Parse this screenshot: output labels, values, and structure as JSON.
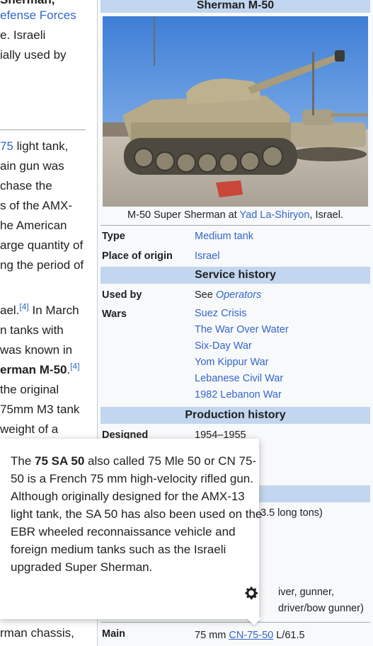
{
  "left_text": {
    "l0": "Sherman,",
    "l1": "efense Forces",
    "l2": "e. Israeli",
    "l3": "ially used by",
    "l4a": "75",
    "l4b": " light tank,",
    "l5": "ain gun was",
    "l6": "chase the",
    "l7": "s of the AMX-",
    "l8": "he American",
    "l9": "arge quantity of",
    "l10": "ng the period of",
    "l11a": "ael.",
    "l11ref": "[4]",
    "l11b": " In March",
    "l12": "n tanks with",
    "l13": " was known in",
    "l14a": "erman M-50",
    "l14b": ".",
    "l14ref": "[4]",
    "l15": " the original",
    "l16": "75mm M3 tank",
    "l17": "weight of a",
    "l18": "rman chassis,"
  },
  "infobox": {
    "title": "Sherman M-50",
    "caption_prefix": "M-50 Super Sherman at ",
    "caption_link": "Yad La-Shiryon",
    "caption_suffix": ", Israel.",
    "type_label": "Type",
    "type_value": "Medium tank",
    "origin_label": "Place of origin",
    "origin_value": "Israel",
    "service_header": "Service history",
    "used_by_label": "Used by",
    "used_by_prefix": "See ",
    "used_by_link": "Operators",
    "wars_label": "Wars",
    "wars": [
      "Suez Crisis",
      "The War Over Water",
      "Six-Day War",
      "Yom Kippur War",
      "Lebanese Civil War",
      "1982 Lebanon War"
    ],
    "production_header": "Production history",
    "designed_label": "Designed",
    "designed_value": "1954–1955",
    "weight_partial": "3.5 long tons)",
    "crew_partial_1": "iver, gunner,",
    "crew_partial_2": "driver/bow gunner)",
    "main_label": "Main",
    "main_prefix": "75 mm ",
    "main_link": "CN-75-50",
    "main_suffix": " L/61.5"
  },
  "popup": {
    "t1": "The ",
    "b1": "75 SA 50",
    "t2": " also called 75 Mle 50 or CN 75-50 is a French 75 mm high-velocity rifled gun. Although originally designed for the AMX-13 light tank, the SA 50 has also been used on the EBR wheeled reconnaissance vehicle and foreign medium tanks such as the Israeli upgraded Super Sherman.",
    "settings_icon": "gear-icon"
  },
  "colors": {
    "link": "#3366cc",
    "infobox_header": "#c3d6ef",
    "infobox_bg": "#f8f9fa"
  }
}
